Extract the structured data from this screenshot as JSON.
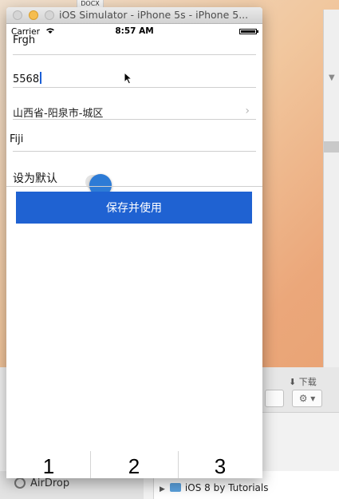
{
  "background": {
    "doc_tab": "DOCX",
    "finder": {
      "download_label": "下载",
      "sidebar_item": "AirDrop",
      "folder": "iOS 8 by Tutorials"
    }
  },
  "simulator": {
    "title": "iOS Simulator - iPhone 5s - iPhone 5..."
  },
  "status_bar": {
    "carrier": "Carrier",
    "time": "8:57 AM"
  },
  "form": {
    "name_value": "Frgh",
    "phone_value": "5568",
    "region_value": "山西省-阳泉市-城区",
    "address_value": "Fiji",
    "default_label": "设为默认",
    "default_on": true,
    "save_label": "保存并使用"
  },
  "tabbar": {
    "tabs": [
      "1",
      "2",
      "3"
    ]
  },
  "colors": {
    "accent": "#1f62d2",
    "toggle": "#2d7bd6"
  }
}
